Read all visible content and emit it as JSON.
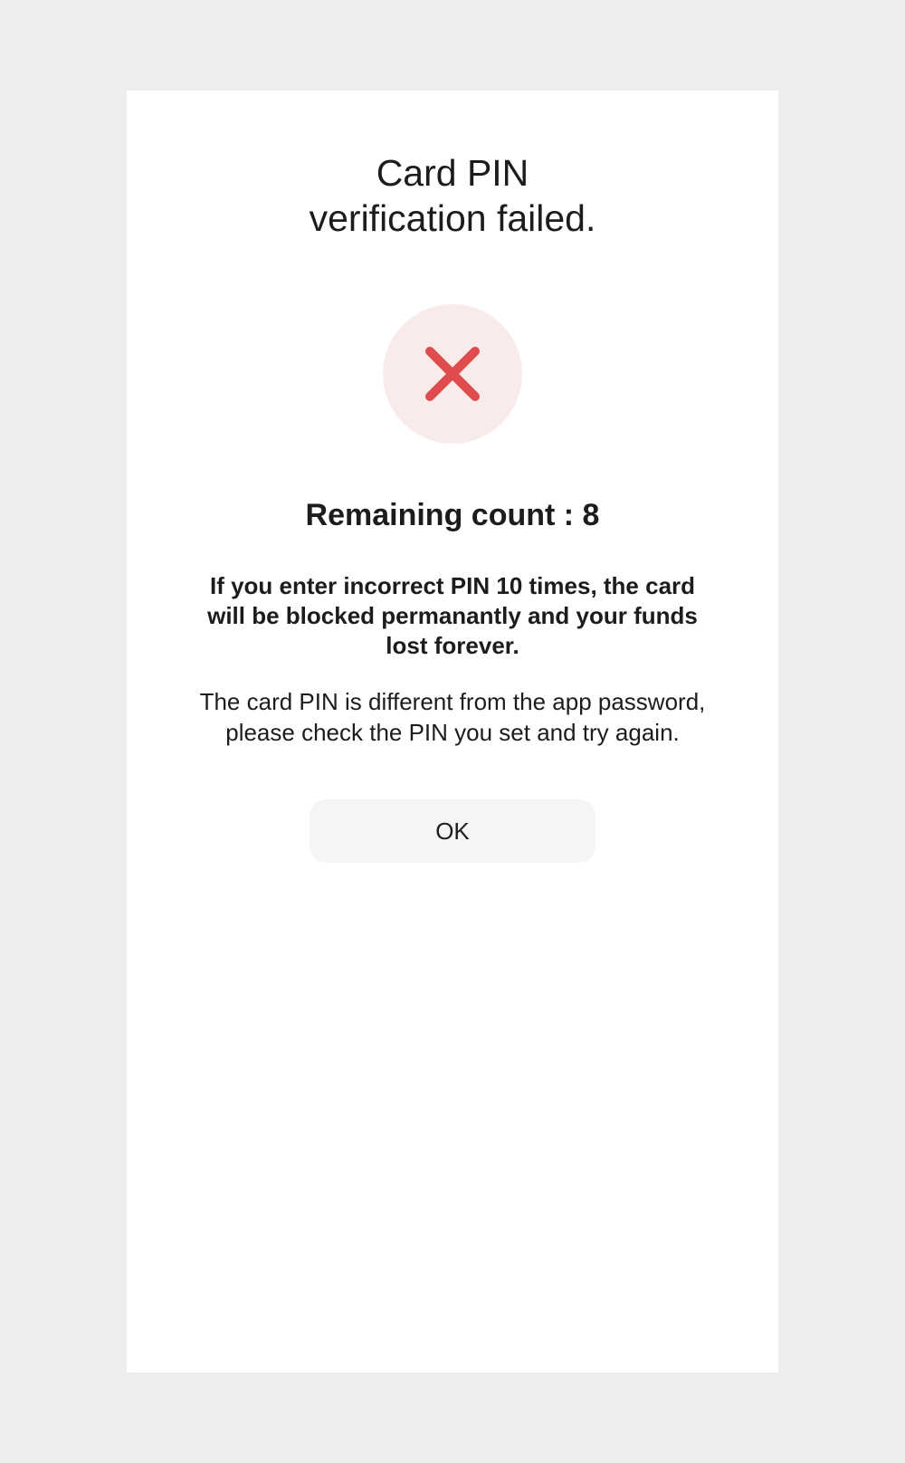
{
  "dialog": {
    "title_line1": "Card PIN",
    "title_line2": "verification failed.",
    "status_icon": "close-x-icon",
    "remaining_text": "Remaining count : 8",
    "warning_text": "If you enter incorrect PIN 10 times, the card will be blocked permanantly and your funds lost forever.",
    "info_text": "The card PIN is different from the app password, please check the PIN you set and try again.",
    "ok_label": "OK"
  },
  "colors": {
    "page_background": "#ededed",
    "card_background": "#ffffff",
    "error_red": "#e04c4c",
    "error_circle_background": "#faebeb",
    "button_background": "#f5f5f5",
    "text": "#1c1c1c"
  }
}
